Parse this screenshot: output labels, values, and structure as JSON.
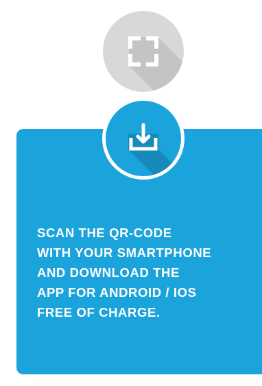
{
  "icons": {
    "scan": "scan-frame-icon",
    "download": "download-icon"
  },
  "colors": {
    "scan_circle": "#d8d8d8",
    "scan_shadow": "#c4c4c4",
    "accent_blue": "#1ba3dc",
    "download_shadow": "#1789bb",
    "text": "#ffffff"
  },
  "instructions": {
    "lines": [
      "SCAN THE QR-CODE",
      "WITH YOUR SMARTPHONE",
      "AND DOWNLOAD THE",
      "APP FOR ANDROID / IOS",
      "FREE OF CHARGE."
    ]
  }
}
